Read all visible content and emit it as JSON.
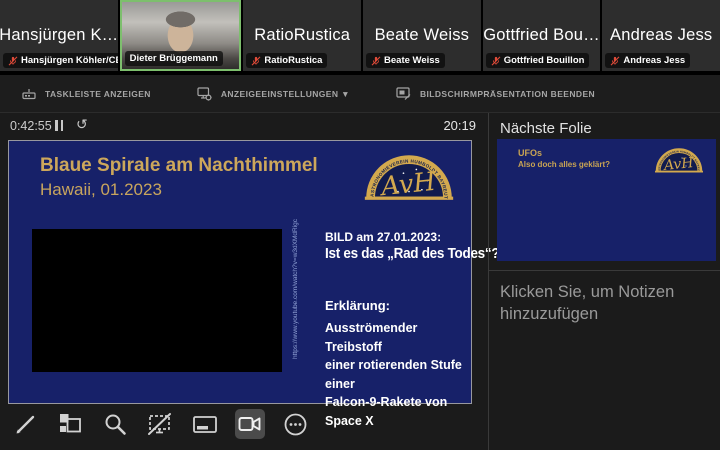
{
  "participants": {
    "tiles": [
      {
        "display_name": "Hansjürgen K…",
        "label": "Hansjürgen Köhler/CE…",
        "muted": true,
        "video": false
      },
      {
        "display_name": "",
        "label": "Dieter Brüggemann",
        "muted": false,
        "video": true
      },
      {
        "display_name": "RatioRustica",
        "label": "RatioRustica",
        "muted": true,
        "video": false
      },
      {
        "display_name": "Beate Weiss",
        "label": "Beate Weiss",
        "muted": true,
        "video": false
      },
      {
        "display_name": "Gottfried Bou…",
        "label": "Gottfried Bouillon",
        "muted": true,
        "video": false
      },
      {
        "display_name": "Andreas Jess",
        "label": "Andreas Jess",
        "muted": true,
        "video": false
      }
    ]
  },
  "ppt_toolbar": {
    "items": [
      {
        "label": "TASKLEISTE ANZEIGEN",
        "icon": "taskbar-icon"
      },
      {
        "label": "ANZEIGEEINSTELLUNGEN ▼",
        "icon": "display-settings-icon"
      },
      {
        "label": "BILDSCHIRMPRÄSENTATION BEENDEN",
        "icon": "end-presentation-icon"
      }
    ]
  },
  "presenter": {
    "timer": "0:42:55",
    "clock": "20:19",
    "icons": {
      "restart": "↺"
    },
    "slide": {
      "title": "Blaue Spirale am Nachthimmel",
      "subtitle": "Hawaii, 01.2023",
      "video_url_vertical": "https://www.youtube.com/watch?v=w3dXMdRigc",
      "heading1": "BILD am 27.01.2023:",
      "heading2": "Ist es das „Rad des Todes“?",
      "explanation_title": "Erklärung:",
      "explanation_lines": [
        "Ausströmender Treibstoff",
        "einer rotierenden Stufe einer",
        "Falcon-9-Rakete von Space X"
      ],
      "logo": {
        "arc_text": "ASTRONOMIEVEREIN HUMBOLDT BAYREUTH E.V.",
        "script": "AvH"
      }
    },
    "next_slide": {
      "header": "Nächste Folie",
      "title": "UFOs",
      "subtitle": "Also doch alles geklärt?"
    },
    "notes_placeholder": "Klicken Sie, um Notizen hinzuzufügen"
  },
  "colors": {
    "slide_blue": "#172169",
    "slide_gold": "#c9a453",
    "active_speaker_green": "#7dbf6d",
    "muted_mic_red": "#e14b39",
    "panel_bg": "#1b1b1b"
  }
}
